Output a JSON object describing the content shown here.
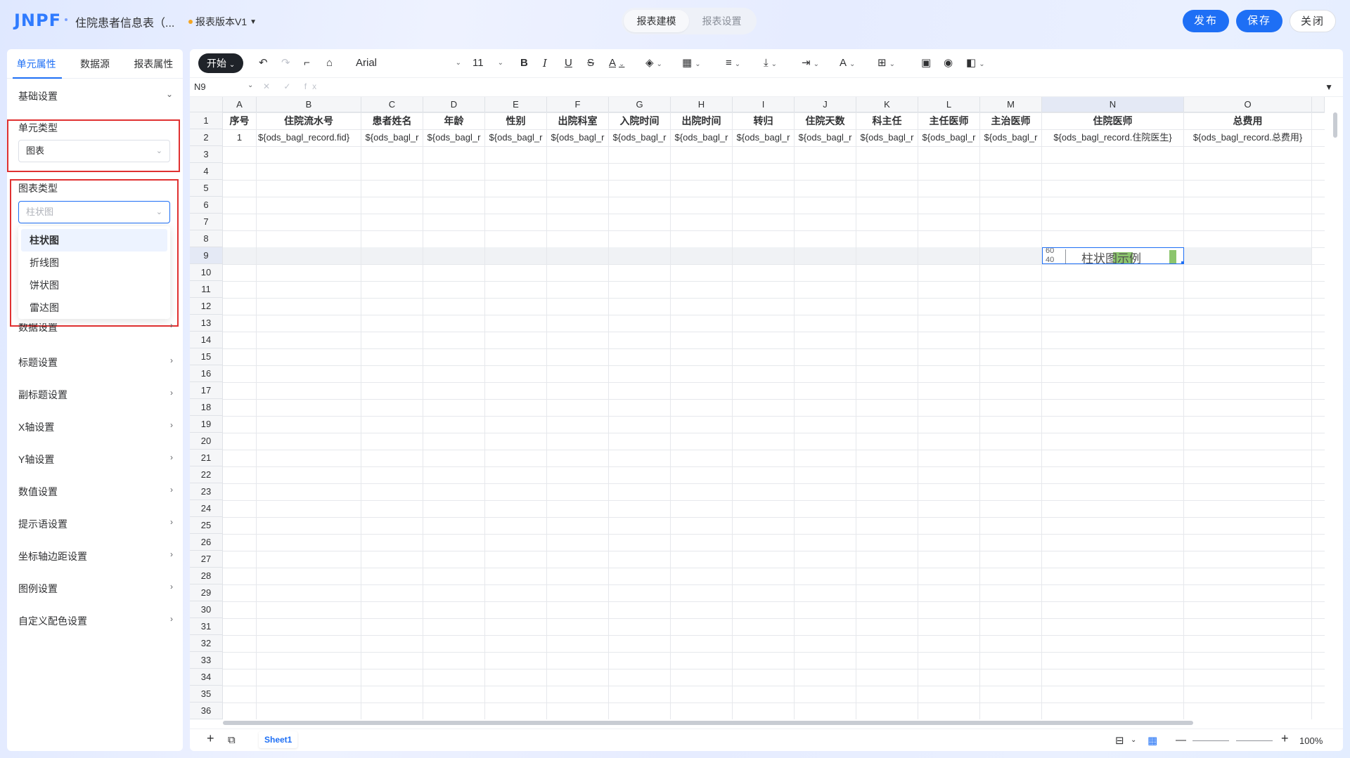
{
  "header": {
    "logo": "JNPF",
    "doc_title": "住院患者信息表（...",
    "version": "报表版本V1",
    "seg_tabs": [
      "报表建模",
      "报表设置"
    ],
    "publish": "发布",
    "save": "保存",
    "close": "关闭"
  },
  "left": {
    "tabs": [
      "单元属性",
      "数据源",
      "报表属性"
    ],
    "basic": "基础设置",
    "cell_type_label": "单元类型",
    "cell_type_value": "图表",
    "chart_type_label": "图表类型",
    "chart_type_placeholder": "柱状图",
    "options": [
      "柱状图",
      "折线图",
      "饼状图",
      "雷达图"
    ],
    "sections": [
      "数据设置",
      "标题设置",
      "副标题设置",
      "X轴设置",
      "Y轴设置",
      "数值设置",
      "提示语设置",
      "坐标轴边距设置",
      "图例设置",
      "自定义配色设置"
    ]
  },
  "toolbar": {
    "start": "开始",
    "font": "Arial",
    "size": "11"
  },
  "formula": {
    "cell_ref": "N9",
    "icons": "✕ ✓ fx"
  },
  "grid": {
    "columns": [
      "A",
      "B",
      "C",
      "D",
      "E",
      "F",
      "G",
      "H",
      "I",
      "J",
      "K",
      "L",
      "M",
      "N",
      "O"
    ],
    "rows": [
      "1",
      "2",
      "3",
      "4",
      "5",
      "6",
      "7",
      "8",
      "9",
      "10",
      "11",
      "12",
      "13",
      "14",
      "15",
      "16",
      "17",
      "18",
      "19",
      "20",
      "21",
      "22",
      "23",
      "24",
      "25",
      "26",
      "27",
      "28",
      "29",
      "30",
      "31",
      "32",
      "33",
      "34",
      "35",
      "36"
    ],
    "header_row": [
      "序号",
      "住院流水号",
      "患者姓名",
      "年龄",
      "性别",
      "出院科室",
      "入院时间",
      "出院时间",
      "转归",
      "住院天数",
      "科主任",
      "主任医师",
      "主治医师",
      "住院医师",
      "总费用"
    ],
    "data_row": [
      "1",
      "${ods_bagl_record.fid}",
      "${ods_bagl_r",
      "${ods_bagl_r",
      "${ods_bagl_r",
      "${ods_bagl_r",
      "${ods_bagl_r",
      "${ods_bagl_r",
      "${ods_bagl_r",
      "${ods_bagl_r",
      "${ods_bagl_r",
      "${ods_bagl_r",
      "${ods_bagl_r",
      "${ods_bagl_record.住院医生}",
      "${ods_bagl_record.总费用}"
    ],
    "chart_cell": {
      "ticks": [
        "60",
        "40"
      ],
      "label": "柱状图示例",
      "bar_color": "#8cc56d"
    }
  },
  "bottom": {
    "sheet": "Sheet1",
    "zoom": "100%"
  }
}
